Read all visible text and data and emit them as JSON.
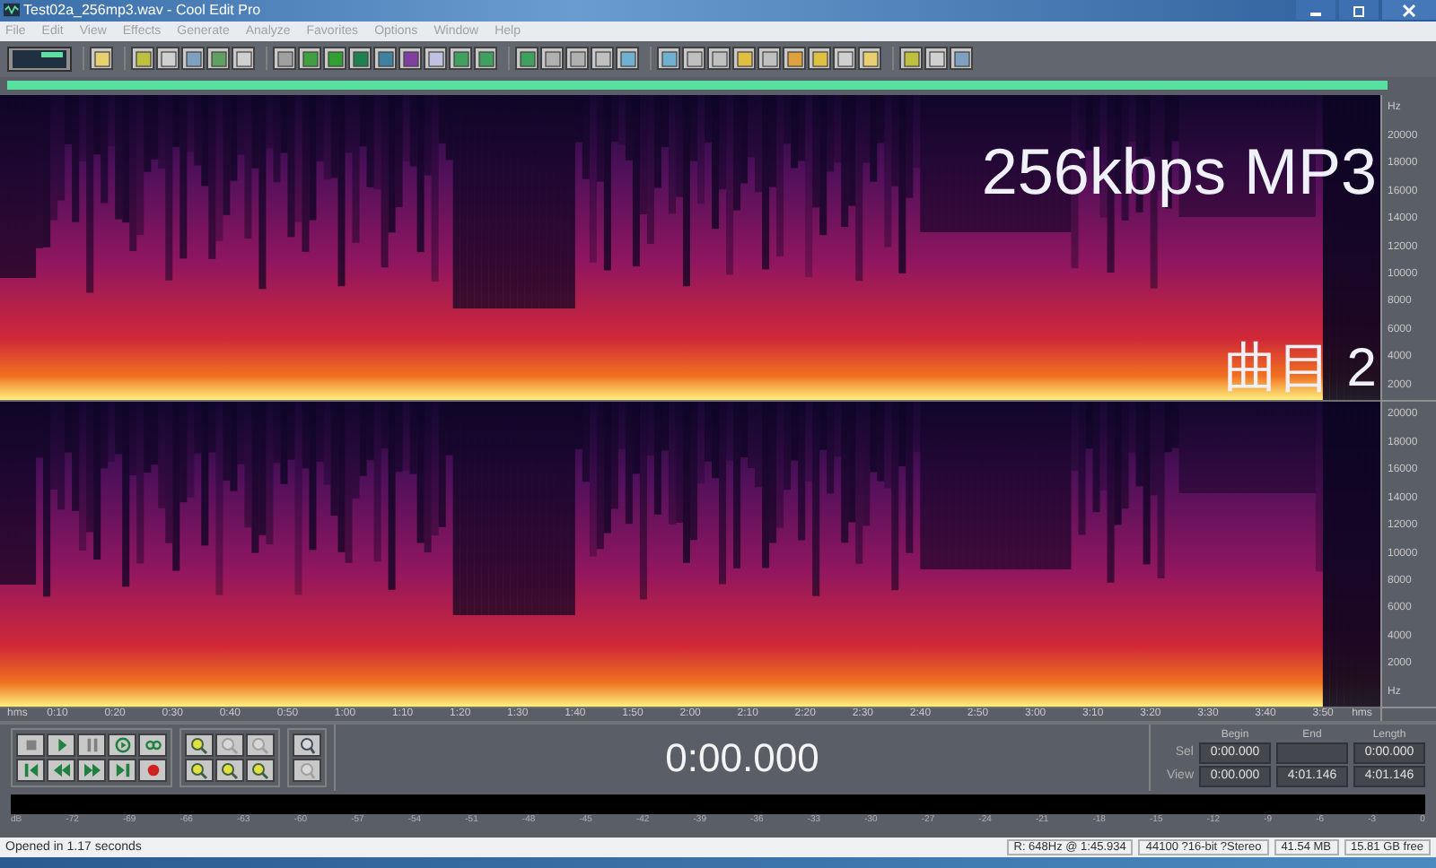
{
  "window": {
    "title": "Test02a_256mp3.wav - Cool Edit Pro"
  },
  "menu": [
    "File",
    "Edit",
    "View",
    "Effects",
    "Generate",
    "Analyze",
    "Favorites",
    "Options",
    "Window",
    "Help"
  ],
  "overlay_labels": [
    "256kbps MP3",
    "曲目 2"
  ],
  "freq_axes": [
    {
      "unit": "Hz",
      "ticks": [
        "20000",
        "18000",
        "16000",
        "14000",
        "12000",
        "10000",
        "8000",
        "6000",
        "4000",
        "2000"
      ]
    },
    {
      "ticks": [
        "20000",
        "18000",
        "16000",
        "14000",
        "12000",
        "10000",
        "8000",
        "6000",
        "4000",
        "2000"
      ],
      "unit": "Hz"
    }
  ],
  "time_axis": {
    "unit_start": "hms",
    "unit_end": "hms",
    "ticks": [
      "0:10",
      "0:20",
      "0:30",
      "0:40",
      "0:50",
      "1:00",
      "1:10",
      "1:20",
      "1:30",
      "1:40",
      "1:50",
      "2:00",
      "2:10",
      "2:20",
      "2:30",
      "2:40",
      "2:50",
      "3:00",
      "3:10",
      "3:20",
      "3:30",
      "3:40",
      "3:50"
    ]
  },
  "time_display": "0:00.000",
  "selection": {
    "columns": [
      "Begin",
      "End",
      "Length"
    ],
    "rows": [
      {
        "label": "Sel",
        "begin": "0:00.000",
        "length": "0:00.000"
      },
      {
        "label": "View",
        "begin": "0:00.000",
        "end": "4:01.146",
        "length": "4:01.146"
      }
    ]
  },
  "level_meter": {
    "labels": [
      "dB",
      "-72",
      "-69",
      "-66",
      "-63",
      "-60",
      "-57",
      "-54",
      "-51",
      "-48",
      "-45",
      "-42",
      "-39",
      "-36",
      "-33",
      "-30",
      "-27",
      "-24",
      "-21",
      "-18",
      "-15",
      "-12",
      "-9",
      "-6",
      "-3",
      "0"
    ]
  },
  "status_bar": {
    "message": "Opened in 1.17 seconds",
    "fields": [
      "R: 648Hz @  1:45.934",
      "44100 ?16-bit ?Stereo",
      "41.54 MB",
      "15.81 GB free"
    ]
  }
}
